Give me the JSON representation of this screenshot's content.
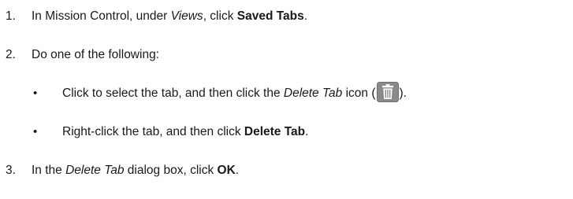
{
  "steps": [
    {
      "num": "1.",
      "parts": [
        "In Mission Control, under ",
        "Views",
        ", click ",
        "Saved Tabs",
        "."
      ]
    },
    {
      "num": "2.",
      "text": "Do one of the following:"
    },
    {
      "num": "3.",
      "parts": [
        "In the ",
        "Delete Tab",
        " dialog box, click ",
        "OK",
        "."
      ]
    }
  ],
  "bullets": [
    {
      "symbol": "•",
      "parts": [
        "Click to select the tab, and then click the ",
        "Delete Tab",
        " icon (",
        ")."
      ]
    },
    {
      "symbol": "•",
      "parts": [
        "Right-click the tab, and then click ",
        "Delete Tab",
        "."
      ]
    }
  ],
  "icons": {
    "delete_tab": "trash-can-icon",
    "delete_tab_bg": "#8a8a8a",
    "delete_tab_fg": "#ffffff"
  }
}
